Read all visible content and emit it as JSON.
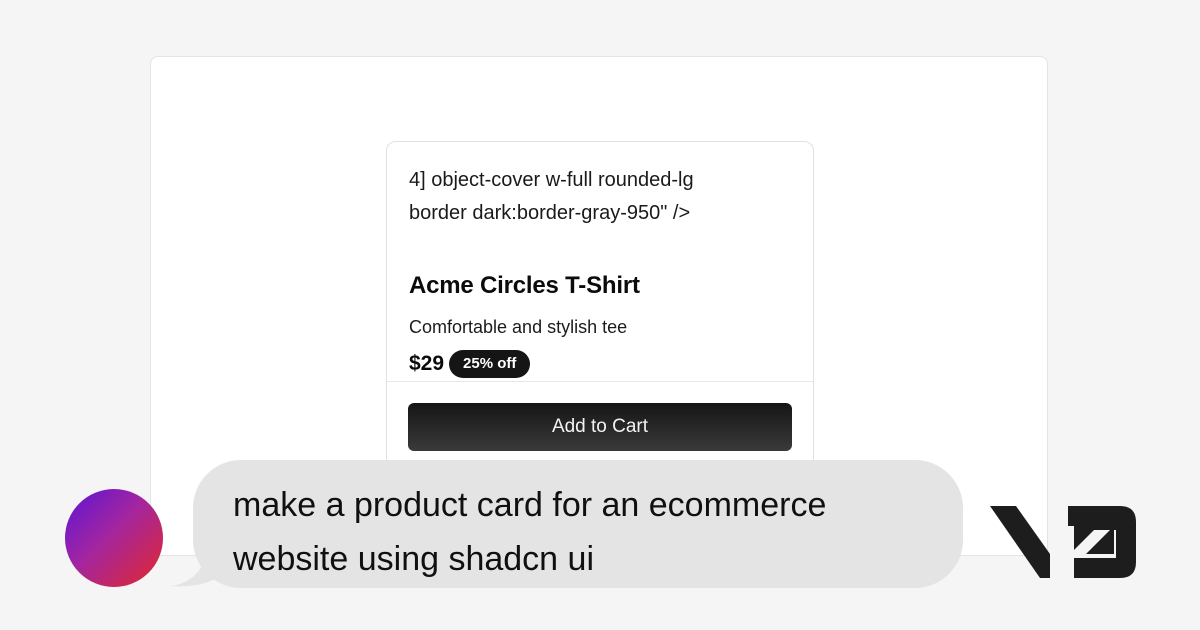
{
  "preview": {
    "card": {
      "code_snippet": "4] object-cover w-full rounded-lg\nborder dark:border-gray-950\" />",
      "title": "Acme Circles T-Shirt",
      "description": "Comfortable and stylish tee",
      "price": "$29",
      "discount_badge": "25% off",
      "cta_label": "Add to Cart"
    }
  },
  "chat": {
    "avatar_icon": "user-avatar",
    "prompt": "make a product card for an ecommerce website using shadcn ui"
  },
  "brand": {
    "logo_icon": "v0-logo-icon"
  },
  "colors": {
    "page_background": "#f5f5f5",
    "bubble": "#e4e4e5",
    "button": "#151515",
    "avatar_gradient_start": "#5c14d6",
    "avatar_gradient_end": "#e2292a"
  }
}
